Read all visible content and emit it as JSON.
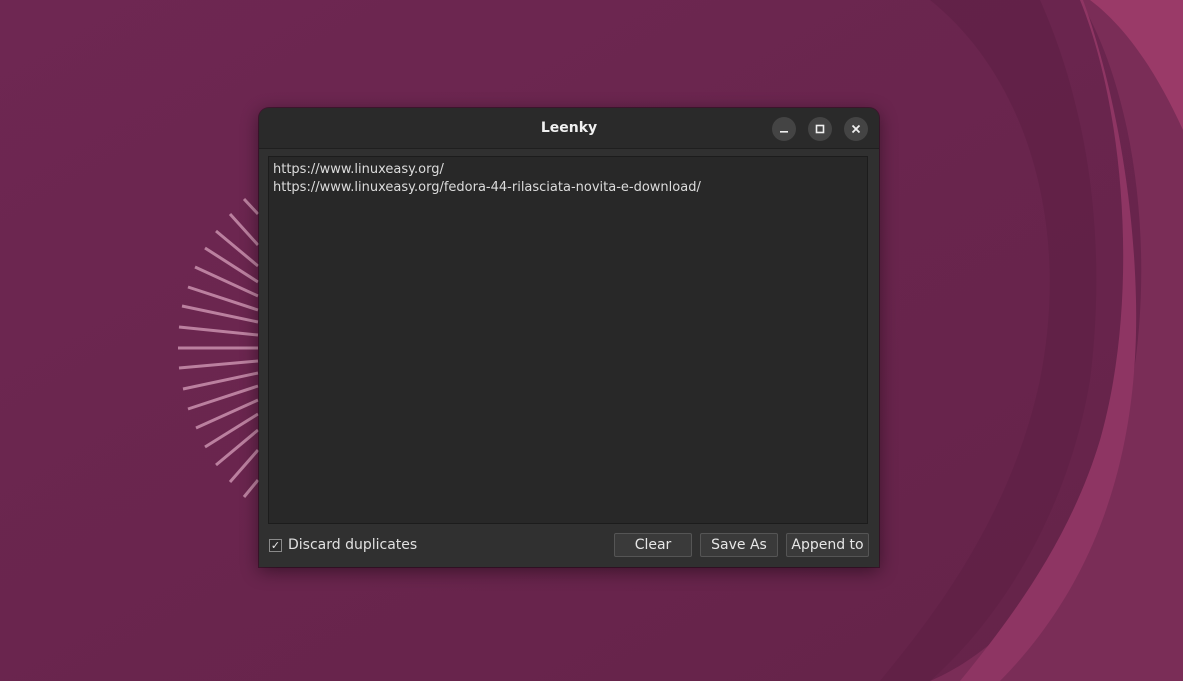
{
  "window": {
    "title": "Leenky"
  },
  "titlebar_buttons": {
    "minimize": "minimize-icon",
    "maximize": "maximize-icon",
    "close": "close-icon"
  },
  "text_area": {
    "lines": [
      "https://www.linuxeasy.org/",
      "https://www.linuxeasy.org/fedora-44-rilasciata-novita-e-download/"
    ]
  },
  "options": {
    "discard_duplicates_label": "Discard duplicates",
    "discard_duplicates_checked": true
  },
  "buttons": {
    "clear_label": "Clear",
    "save_as_label": "Save As",
    "append_to_label": "Append to"
  },
  "colors": {
    "wallpaper": "#6b2650",
    "window_bg": "#303030",
    "text_area_bg": "#282828"
  }
}
